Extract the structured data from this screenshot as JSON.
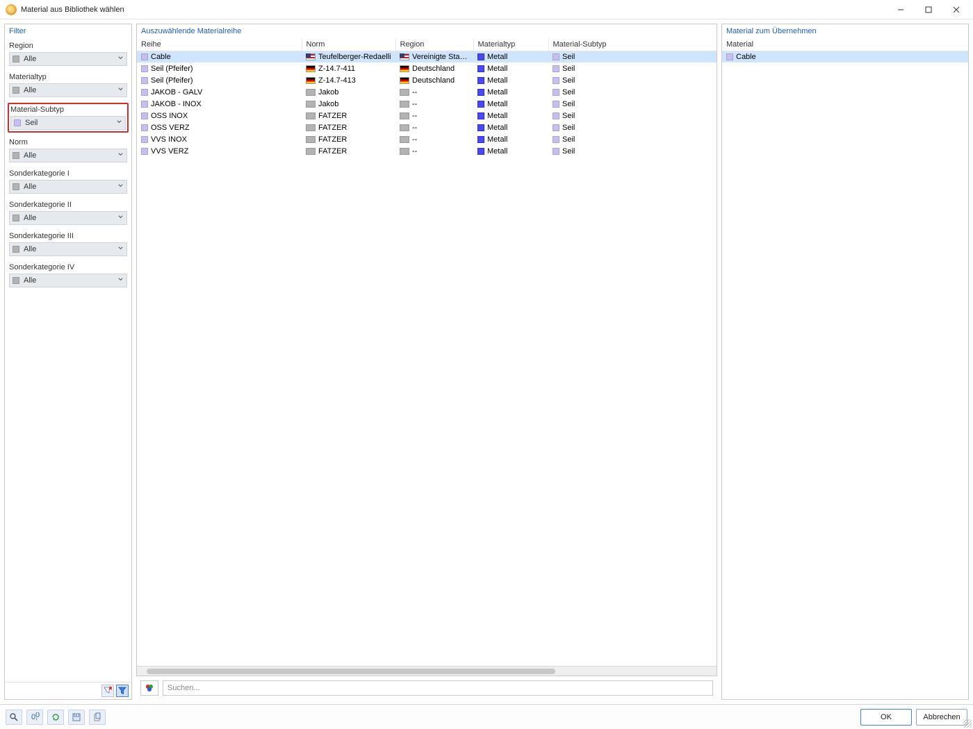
{
  "window": {
    "title": "Material aus Bibliothek wählen"
  },
  "sidebar": {
    "header": "Filter",
    "filters": [
      {
        "label": "Region",
        "value": "Alle",
        "highlight": false,
        "swatch": "gray"
      },
      {
        "label": "Materialtyp",
        "value": "Alle",
        "highlight": false,
        "swatch": "gray"
      },
      {
        "label": "Material-Subtyp",
        "value": "Seil",
        "highlight": true,
        "swatch": "lav"
      },
      {
        "label": "Norm",
        "value": "Alle",
        "highlight": false,
        "swatch": "gray"
      },
      {
        "label": "Sonderkategorie I",
        "value": "Alle",
        "highlight": false,
        "swatch": "gray"
      },
      {
        "label": "Sonderkategorie II",
        "value": "Alle",
        "highlight": false,
        "swatch": "gray"
      },
      {
        "label": "Sonderkategorie III",
        "value": "Alle",
        "highlight": false,
        "swatch": "gray"
      },
      {
        "label": "Sonderkategorie IV",
        "value": "Alle",
        "highlight": false,
        "swatch": "gray"
      }
    ]
  },
  "center": {
    "header": "Auszuwählende Materialreihe",
    "columns": [
      "Reihe",
      "Norm",
      "Region",
      "Materialtyp",
      "Material-Subtyp"
    ],
    "rows": [
      {
        "reihe": "Cable",
        "norm": "Teufelberger-Redaelli",
        "region": "Vereinigte Staat...",
        "flag": "us",
        "typ": "Metall",
        "sub": "Seil",
        "selected": true
      },
      {
        "reihe": "Seil (Pfeifer)",
        "norm": "Z-14.7-411",
        "region": "Deutschland",
        "flag": "de",
        "typ": "Metall",
        "sub": "Seil",
        "selected": false
      },
      {
        "reihe": "Seil (Pfeifer)",
        "norm": "Z-14.7-413",
        "region": "Deutschland",
        "flag": "de",
        "typ": "Metall",
        "sub": "Seil",
        "selected": false
      },
      {
        "reihe": "JAKOB - GALV",
        "norm": "Jakob",
        "region": "--",
        "flag": "gr",
        "typ": "Metall",
        "sub": "Seil",
        "selected": false
      },
      {
        "reihe": "JAKOB - INOX",
        "norm": "Jakob",
        "region": "--",
        "flag": "gr",
        "typ": "Metall",
        "sub": "Seil",
        "selected": false
      },
      {
        "reihe": "OSS INOX",
        "norm": "FATZER",
        "region": "--",
        "flag": "gr",
        "typ": "Metall",
        "sub": "Seil",
        "selected": false
      },
      {
        "reihe": "OSS VERZ",
        "norm": "FATZER",
        "region": "--",
        "flag": "gr",
        "typ": "Metall",
        "sub": "Seil",
        "selected": false
      },
      {
        "reihe": "VVS INOX",
        "norm": "FATZER",
        "region": "--",
        "flag": "gr",
        "typ": "Metall",
        "sub": "Seil",
        "selected": false
      },
      {
        "reihe": "VVS VERZ",
        "norm": "FATZER",
        "region": "--",
        "flag": "gr",
        "typ": "Metall",
        "sub": "Seil",
        "selected": false
      }
    ]
  },
  "right": {
    "header": "Material zum Übernehmen",
    "column": "Material",
    "rows": [
      {
        "name": "Cable",
        "selected": true
      }
    ]
  },
  "search": {
    "placeholder": "Suchen..."
  },
  "footer": {
    "ok": "OK",
    "cancel": "Abbrechen"
  }
}
